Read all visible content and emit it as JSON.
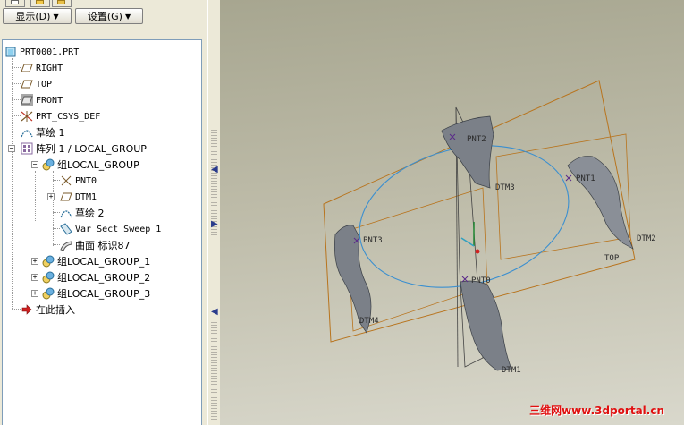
{
  "toolbar": {
    "display_menu": "显示(D)",
    "settings_menu": "设置(G)"
  },
  "tree": {
    "root": "PRT0001.PRT",
    "right": "RIGHT",
    "top": "TOP",
    "front": "FRONT",
    "csys": "PRT_CSYS_DEF",
    "sketch1": "草绘 1",
    "pattern": "阵列 1 / LOCAL_GROUP",
    "group": "组LOCAL_GROUP",
    "pnt0": "PNT0",
    "dtm1": "DTM1",
    "sketch2": "草绘 2",
    "sweep": "Var Sect Sweep 1",
    "surface": "曲面 标识87",
    "group1": "组LOCAL_GROUP_1",
    "group2": "组LOCAL_GROUP_2",
    "group3": "组LOCAL_GROUP_3",
    "insert_here": "在此插入"
  },
  "viewport": {
    "labels": {
      "pnt0": "PNT0",
      "pnt1": "PNT1",
      "pnt2": "PNT2",
      "pnt3": "PNT3",
      "dtm1": "DTM1",
      "dtm2": "DTM2",
      "dtm3": "DTM3",
      "dtm4": "DTM4",
      "top": "TOP"
    },
    "colors": {
      "datum_plane": "#b8741e",
      "sketch_curve": "#3a8fd0",
      "surface": "#7b8088"
    }
  },
  "watermark": "三维网www.3dportal.cn"
}
